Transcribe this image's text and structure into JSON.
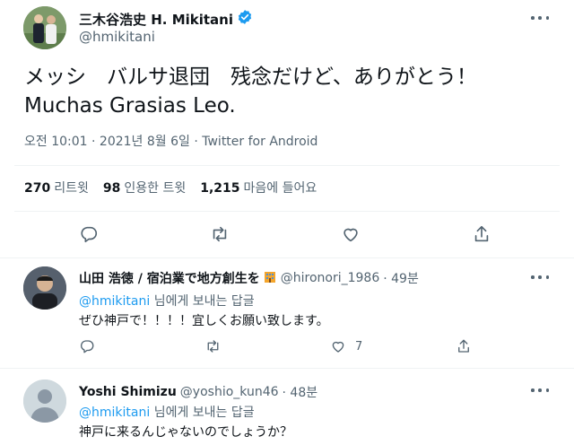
{
  "tweet": {
    "author_name": "三木谷浩史 H. Mikitani",
    "author_handle": "@hmikitani",
    "text_line1": "メッシ　バルサ退団　残念だけど、ありがとう！",
    "text_line2": "Muchas Grasias Leo.",
    "meta": "오전 10:01 · 2021년 8월 6일 · Twitter for Android",
    "stats": {
      "retweets_count": "270",
      "retweets_label": "리트윗",
      "quotes_count": "98",
      "quotes_label": "인용한 트윗",
      "likes_count": "1,215",
      "likes_label": "마음에 들어요"
    }
  },
  "replies": [
    {
      "author_name": "山田 浩徳 / 宿泊業で地方創生を",
      "author_handle": "@hironori_1986",
      "time": "· 49분",
      "reply_to_handle": "@hmikitani",
      "reply_to_suffix": "님에게 보내는 답글",
      "text": "ぜひ神戸で！！！！宜しくお願い致します。",
      "like_count": "7"
    },
    {
      "author_name": "Yoshi Shimizu",
      "author_handle": "@yoshio_kun46",
      "time": "· 48분",
      "reply_to_handle": "@hmikitani",
      "reply_to_suffix": "님에게 보내는 답글",
      "text": "神戸に来るんじゃないのでしょうか？"
    }
  ],
  "colors": {
    "accent": "#1d9bf0",
    "secondary_text": "#536471",
    "divider": "#eff3f4",
    "verified": "#1d9bf0"
  }
}
